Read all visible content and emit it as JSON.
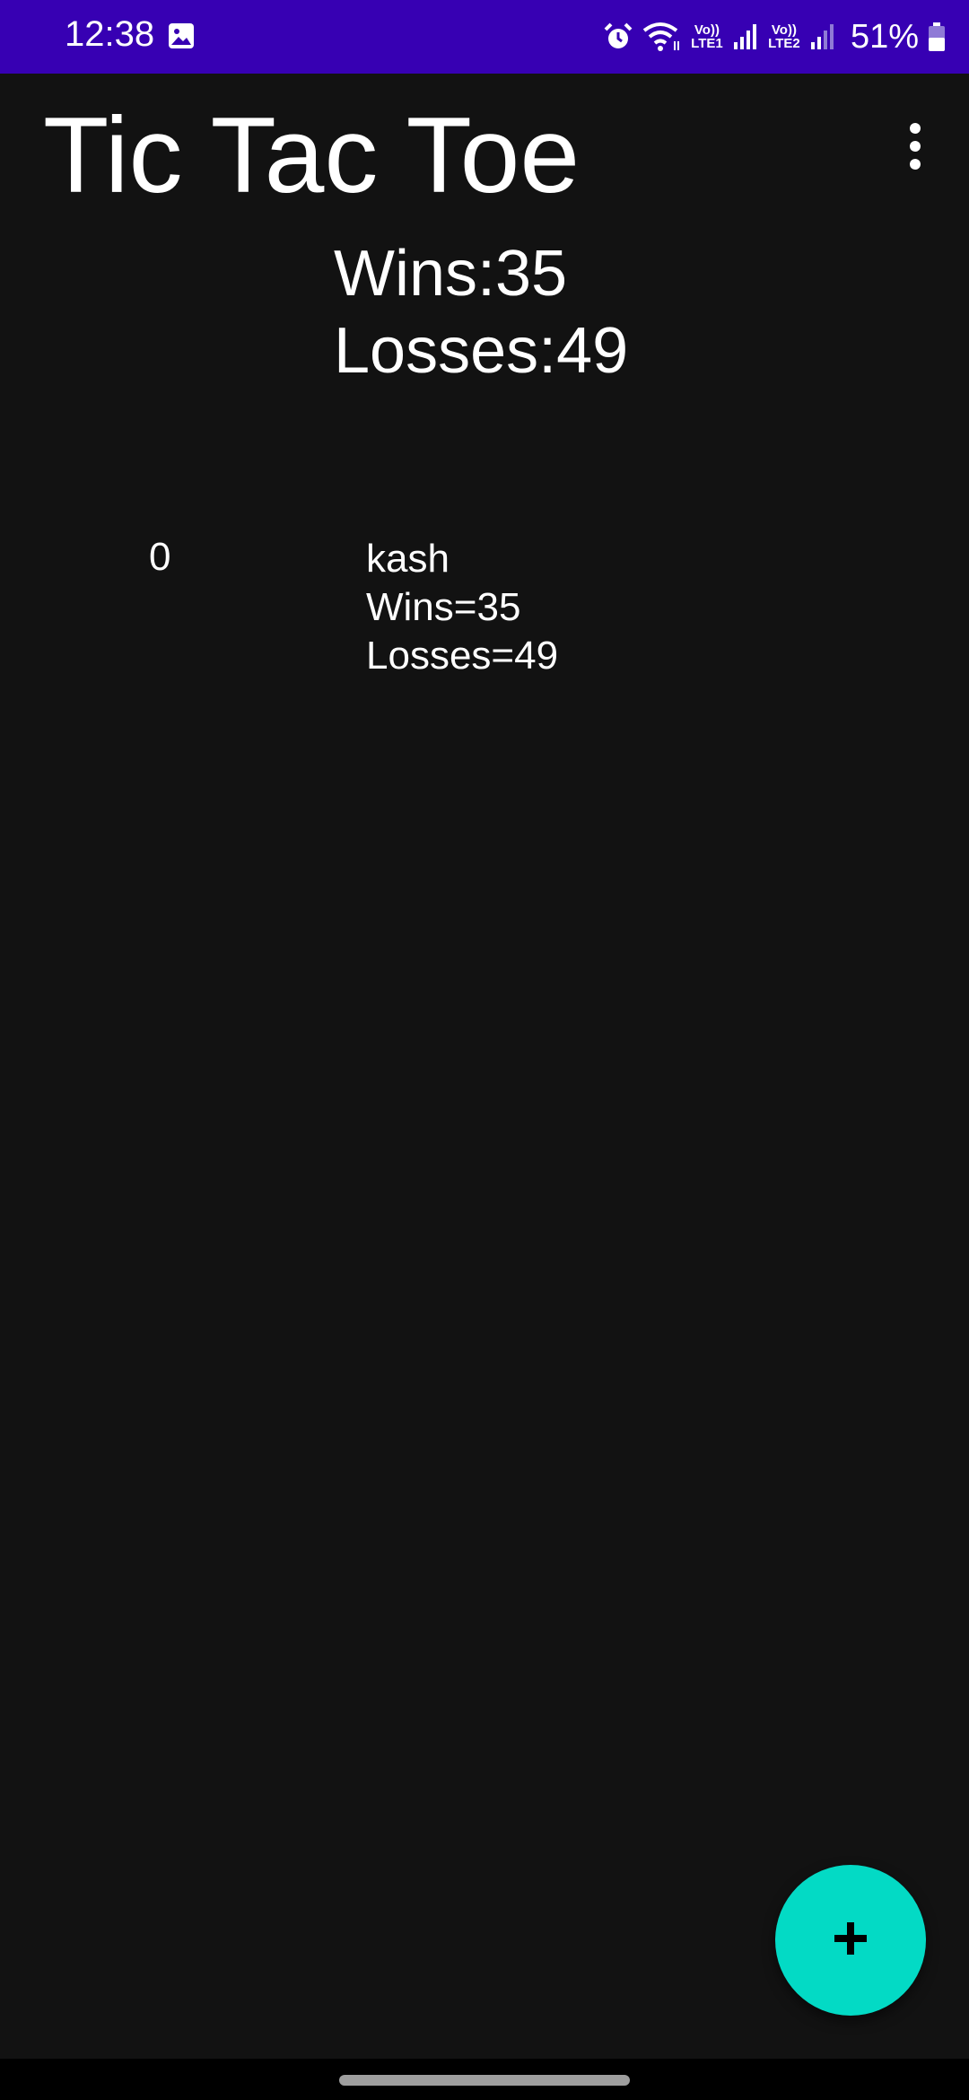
{
  "status_bar": {
    "time": "12:38",
    "battery": "51%",
    "sim1_label": "Vo)) LTE1",
    "sim2_label": "Vo)) LTE2",
    "icons": [
      "gallery-icon",
      "alarm-icon",
      "wifi-icon",
      "signal-icon",
      "battery-icon"
    ],
    "background": "#3700b3"
  },
  "app_bar": {
    "title": "Tic Tac Toe",
    "menu_icon": "more-vert-icon"
  },
  "summary": {
    "wins": "Wins:35",
    "losses": "Losses:49"
  },
  "players": [
    {
      "index": "0",
      "name": "kash",
      "wins": "Wins=35",
      "losses": "Losses=49"
    }
  ],
  "fab": {
    "icon": "plus-icon",
    "color": "#03dac5"
  },
  "theme": {
    "background": "#121212",
    "text": "#ffffff"
  }
}
